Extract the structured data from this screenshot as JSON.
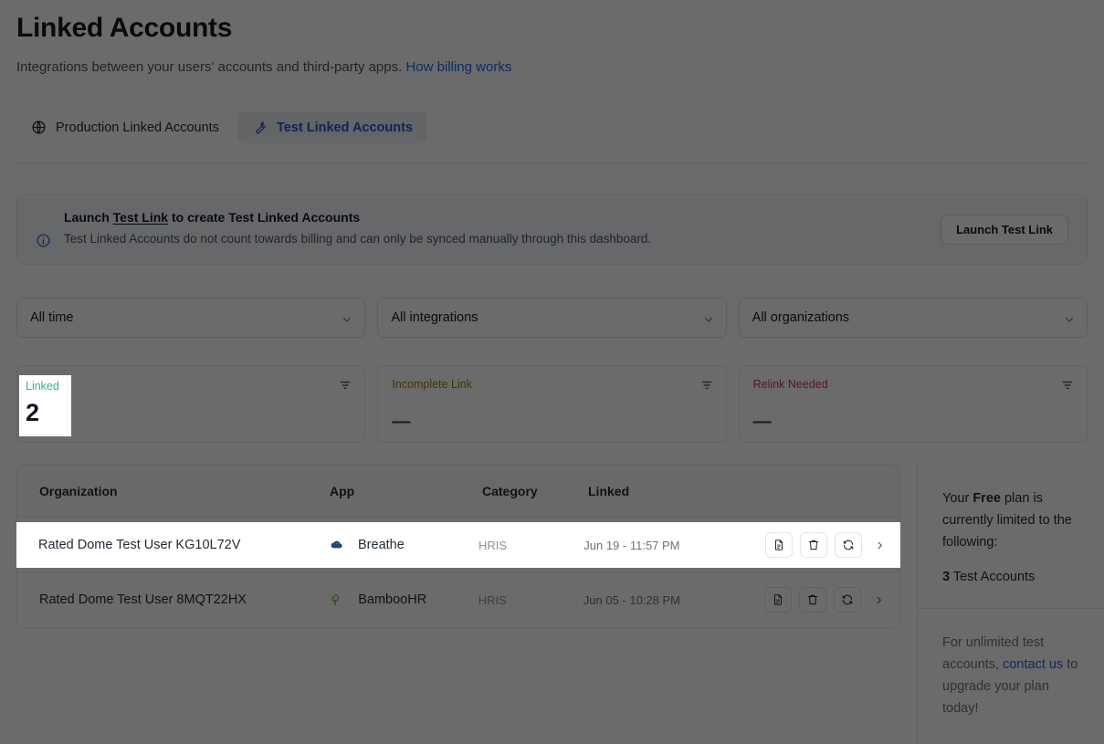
{
  "header": {
    "title": "Linked Accounts",
    "subtitle": "Integrations between your users' accounts and third-party apps.",
    "subtitle_link": "How billing works"
  },
  "tabs": [
    {
      "label": "Production Linked Accounts",
      "icon": "globe-icon",
      "active": false
    },
    {
      "label": "Test Linked Accounts",
      "icon": "wrench-icon",
      "active": true
    }
  ],
  "banner": {
    "icon": "info-icon",
    "title_prefix": "Launch ",
    "title_link": "Test Link",
    "title_suffix": " to create Test Linked Accounts",
    "description": "Test Linked Accounts do not count towards billing and can only be synced manually through this dashboard.",
    "button_label": "Launch Test Link"
  },
  "filters": [
    {
      "value": "All time",
      "icon": "chevron-down-icon"
    },
    {
      "value": "All integrations",
      "icon": "chevron-down-icon"
    },
    {
      "value": "All organizations",
      "icon": "chevron-down-icon"
    }
  ],
  "stats": [
    {
      "label": "Linked",
      "value": "2",
      "color": "#2fb397",
      "filter_icon": "filter-icon"
    },
    {
      "label": "Incomplete Link",
      "value": "—",
      "color": "#a47708",
      "filter_icon": "filter-icon"
    },
    {
      "label": "Relink Needed",
      "value": "—",
      "color": "#cf3a46",
      "filter_icon": "filter-icon"
    }
  ],
  "table": {
    "columns": [
      "Organization",
      "App",
      "Category",
      "Linked"
    ],
    "rows": [
      {
        "organization": "Rated Dome Test User KG10L72V",
        "app": "Breathe",
        "app_logo": "breathe-cloud-logo",
        "category": "HRIS",
        "linked": "Jun 19 - 11:57 PM",
        "actions": [
          "document-icon",
          "trash-icon",
          "sync-icon",
          "chevron-right-icon"
        ]
      },
      {
        "organization": "Rated Dome Test User 8MQT22HX",
        "app": "BambooHR",
        "app_logo": "bamboo-leaf-logo",
        "category": "HRIS",
        "linked": "Jun 05 - 10:28 PM",
        "actions": [
          "document-icon",
          "trash-icon",
          "sync-icon",
          "chevron-right-icon"
        ]
      }
    ]
  },
  "plan_panel": {
    "line_prefix": "Your ",
    "plan_name": "Free",
    "line_suffix": " plan is currently limited to the following:",
    "limit_count": "3",
    "limit_label": " Test Accounts",
    "footer_prefix": "For unlimited test accounts, ",
    "footer_link": "contact us",
    "footer_suffix": " to upgrade your plan today!"
  },
  "colors": {
    "accent_blue": "#2563eb",
    "tab_active_blue": "#2454c9",
    "linked_teal": "#2fb397",
    "incomplete_amber": "#a47708",
    "relink_red": "#cf3a46",
    "dim_overlay": "rgba(0,0,0,0.58)"
  }
}
